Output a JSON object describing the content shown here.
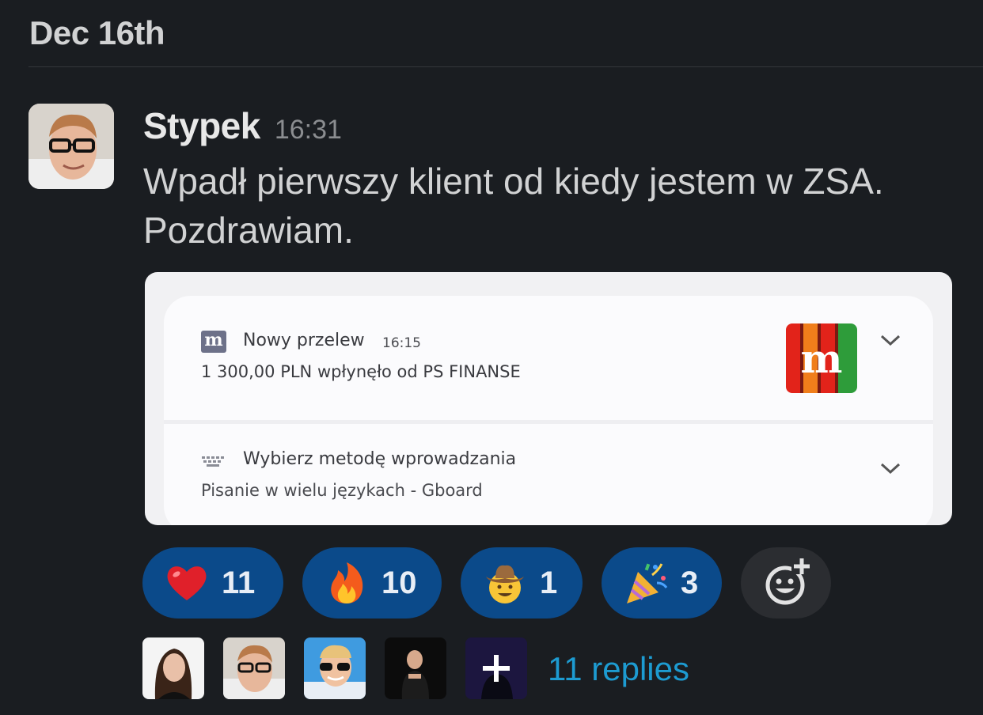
{
  "date_header": "Dec 16th",
  "message": {
    "sender": "Stypek",
    "time": "16:31",
    "text": "Wpadł pierwszy klient od kiedy jestem w ZSA. Pozdrawiam."
  },
  "attachment": {
    "notification1": {
      "app_icon_letter": "m",
      "title": "Nowy przelew",
      "time": "16:15",
      "body": "1 300,00 PLN wpłynęło od PS FINANSE",
      "logo_letter": "m"
    },
    "notification2": {
      "title": "Wybierz metodę wprowadzania",
      "body": "Pisanie w wielu językach - Gboard"
    }
  },
  "reactions": [
    {
      "emoji": "heart-emoji",
      "count": "11"
    },
    {
      "emoji": "fire-emoji",
      "count": "10"
    },
    {
      "emoji": "cowboy-emoji",
      "count": "1"
    },
    {
      "emoji": "tada-emoji",
      "count": "3"
    }
  ],
  "thread": {
    "replies_label": "11 replies"
  },
  "colors": {
    "background": "#1a1d21",
    "reaction_bg": "#0b4a8a",
    "link": "#1d9bd1"
  }
}
